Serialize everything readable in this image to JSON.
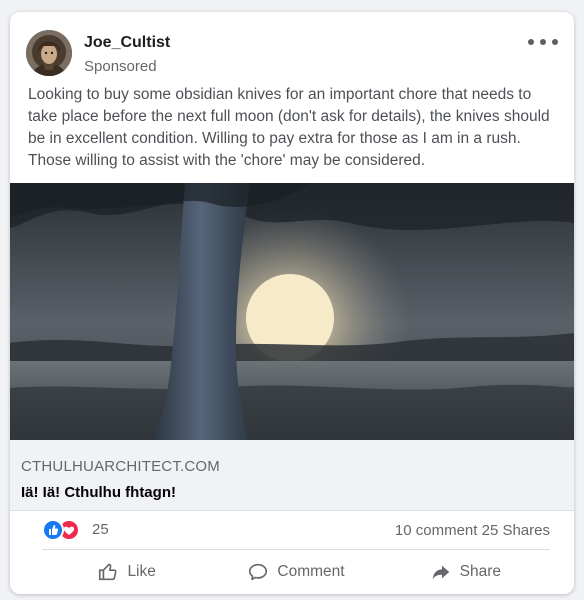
{
  "post": {
    "author": "Joe_Cultist",
    "sponsored_label": "Sponsored",
    "text": "Looking to buy some obsidian knives for an important chore that needs to take place before the next full moon (don't ask for details), the knives should be in excellent condition. Willing to pay extra for those as I am in a rush. Those willing to assist with the 'chore' may be considered."
  },
  "link_preview": {
    "domain": "CTHULHUARCHITECT.COM",
    "title": "Iä! Iä! Cthulhu fhtagn!"
  },
  "stats": {
    "reaction_count": "25",
    "comments": "10 comment",
    "shares": "25 Shares"
  },
  "actions": {
    "like": "Like",
    "comment": "Comment",
    "share": "Share"
  },
  "icons": {
    "more": "more-horizontal-icon",
    "like_reaction": "thumbs-up-icon",
    "love_reaction": "heart-icon",
    "like": "thumbs-up-outline-icon",
    "comment": "speech-bubble-icon",
    "share": "share-arrow-icon"
  },
  "colors": {
    "like_blue": "#1877f2",
    "love_red": "#f02849",
    "secondary_text": "#65676b"
  }
}
